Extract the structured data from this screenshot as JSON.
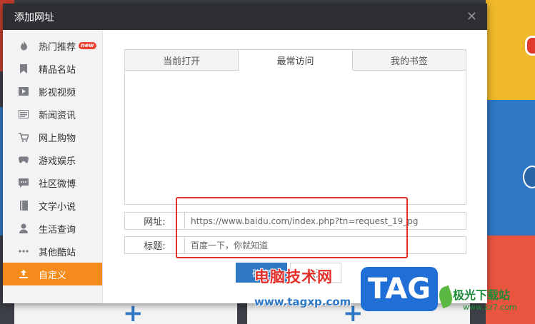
{
  "dialog": {
    "title": "添加网址",
    "close_icon": "close-icon"
  },
  "sidebar": {
    "items": [
      {
        "label": "热门推荐",
        "icon": "flame-icon",
        "badge": "new"
      },
      {
        "label": "精品名站",
        "icon": "bookmark-icon"
      },
      {
        "label": "影视视频",
        "icon": "play-icon"
      },
      {
        "label": "新闻资讯",
        "icon": "news-icon"
      },
      {
        "label": "网上购物",
        "icon": "cart-icon"
      },
      {
        "label": "游戏娱乐",
        "icon": "gamepad-icon"
      },
      {
        "label": "社区微博",
        "icon": "chat-icon"
      },
      {
        "label": "文学小说",
        "icon": "book-icon"
      },
      {
        "label": "生活查询",
        "icon": "user-icon"
      },
      {
        "label": "其他酷站",
        "icon": "more-icon"
      },
      {
        "label": "自定义",
        "icon": "custom-icon",
        "active": true
      }
    ]
  },
  "tabs": [
    {
      "label": "当前打开"
    },
    {
      "label": "最常访问",
      "active": true
    },
    {
      "label": "我的书签"
    }
  ],
  "form": {
    "url_label": "网址:",
    "url_value": "https://www.baidu.com/index.php?tn=request_19_pg",
    "title_label": "标题:",
    "title_value": "百度一下，你就知道"
  },
  "buttons": {
    "confirm": "确定",
    "cancel": "取消"
  },
  "watermark": {
    "cn_text": "电脑技术网",
    "url_text": "www.tagxp.com",
    "tag_text": "TAG",
    "site_text": "极光下载站",
    "site_url": "www.xz7.com"
  },
  "colors": {
    "header_bg": "#2e2f33",
    "active_sidebar": "#f58b1d",
    "primary_button": "#2f78c5",
    "highlight": "#e2302a"
  }
}
